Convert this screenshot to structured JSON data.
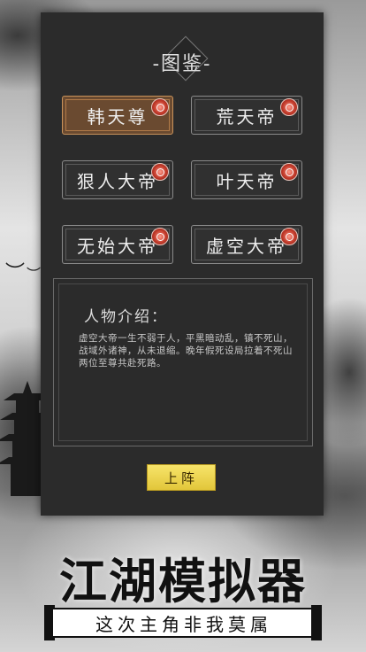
{
  "codex": {
    "title": "-图鉴-",
    "characters": [
      {
        "name": "韩天尊",
        "selected": true
      },
      {
        "name": "荒天帝",
        "selected": false
      },
      {
        "name": "狠人大帝",
        "selected": false
      },
      {
        "name": "叶天帝",
        "selected": false
      },
      {
        "name": "无始大帝",
        "selected": false
      },
      {
        "name": "虚空大帝",
        "selected": false
      }
    ],
    "intro_heading": "人物介绍：",
    "intro_text": "虚空大帝一生不弱于人，平黑暗动乱，镇不死山，战域外诸神，从未退缩。晚年假死设局拉着不死山两位至尊共赴死路。",
    "deploy_label": "上阵"
  },
  "promo": {
    "game_title": "江湖模拟器",
    "tagline": "这次主角非我莫属"
  },
  "colors": {
    "panel": "#2b2b2b",
    "selected": "#6a4a30",
    "deploy": "#f0d850",
    "seal": "#c23a2a"
  }
}
